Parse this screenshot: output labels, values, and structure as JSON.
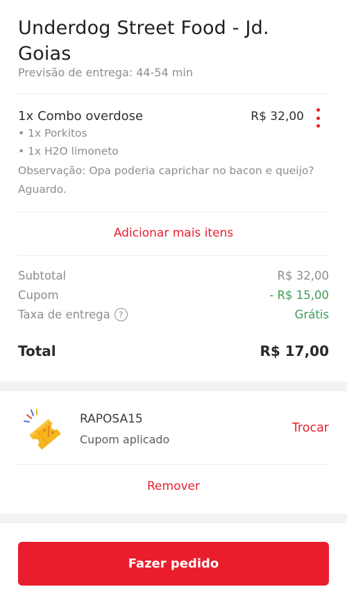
{
  "store": {
    "name": "Underdog Street Food - Jd. Goias",
    "eta": "Previsão de entrega: 44-54 min"
  },
  "item": {
    "qty": "1x",
    "name": "Combo overdose",
    "price": "R$ 32,00",
    "subitems": [
      "• 1x Porkitos",
      "• 1x H2O limoneto"
    ],
    "observation": "Observação: Opa poderia caprichar no bacon e queijo? Aguardo."
  },
  "add_more_label": "Adicionar mais itens",
  "summary": {
    "subtotal_label": "Subtotal",
    "subtotal_value": "R$ 32,00",
    "coupon_label": "Cupom",
    "coupon_value": "- R$ 15,00",
    "delivery_label": "Taxa de entrega",
    "delivery_help": "?",
    "delivery_value": "Grátis",
    "total_label": "Total",
    "total_value": "R$ 17,00"
  },
  "coupon": {
    "code": "RAPOSA15",
    "status": "Cupom aplicado",
    "change_label": "Trocar",
    "remove_label": "Remover"
  },
  "cta_label": "Fazer pedido",
  "colors": {
    "accent": "#ea1d2c",
    "success": "#3d9a57",
    "ticket": "#f7b520"
  }
}
